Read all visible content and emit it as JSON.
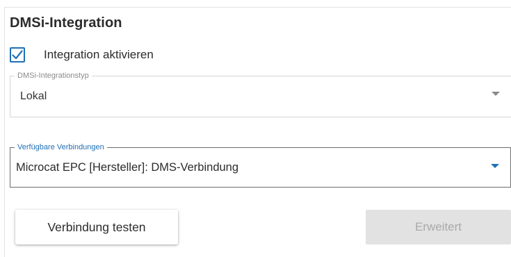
{
  "section": {
    "title": "DMSi-Integration"
  },
  "integration_checkbox": {
    "label": "Integration aktivieren",
    "checked": true
  },
  "integration_type": {
    "label": "DMSi-Integrationstyp",
    "value": "Lokal"
  },
  "connections": {
    "label": "Verfügbare Verbindungen",
    "value": "Microcat EPC [Hersteller]: DMS-Verbindung"
  },
  "buttons": {
    "test_label": "Verbindung testen",
    "advanced_label": "Erweitert",
    "advanced_enabled": false
  },
  "colors": {
    "accent": "#1f6fb5",
    "disabled_bg": "#e2e2e2",
    "disabled_text": "#a9a9a9"
  }
}
